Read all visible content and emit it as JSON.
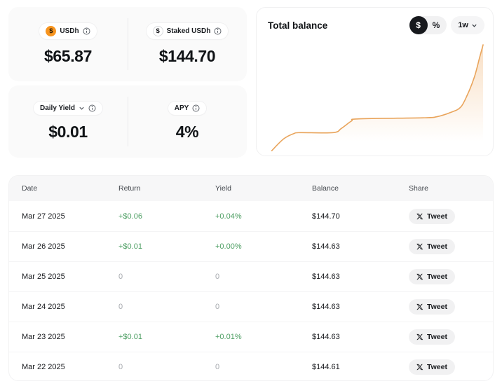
{
  "colors": {
    "accent_orange": "#f7941e",
    "chart_line": "#e9a45b",
    "chart_fill_top": "rgba(238,171,101,0.38)",
    "positive_green": "#4c9e62",
    "zero_gray": "#a6a9ae"
  },
  "stats": {
    "usdh": {
      "label": "USDh",
      "value": "$65.87",
      "coin_symbol": "$"
    },
    "staked": {
      "label": "Staked USDh",
      "value": "$144.70",
      "coin_symbol": "$"
    },
    "daily_yield": {
      "label": "Daily Yield",
      "value": "$0.01"
    },
    "apy": {
      "label": "APY",
      "value": "4%"
    }
  },
  "chart_header": {
    "title": "Total balance",
    "toggle": {
      "selected": "$",
      "unselected": "%"
    },
    "range": "1w"
  },
  "chart_data": {
    "type": "area",
    "title": "Total balance",
    "xlabel": "",
    "ylabel": "",
    "axes_visible": false,
    "grid": false,
    "legend": "none",
    "range_selected": "1w",
    "unit_selected": "$",
    "series": [
      {
        "name": "Total balance (relative, 0-100 of peak; no axis labels shown)",
        "x_rel": [
          2.5,
          7.9,
          12.6,
          15.7,
          30.8,
          34.6,
          39.3,
          42.5,
          72.3,
          78.6,
          84.9,
          89.6,
          92.8,
          95.9,
          98.4,
          100
        ],
        "values_rel": [
          0,
          11,
          16,
          17,
          17,
          21,
          28,
          30,
          31,
          32,
          36,
          41,
          53,
          69,
          88,
          100
        ]
      }
    ]
  },
  "table": {
    "columns": [
      "Date",
      "Return",
      "Yield",
      "Balance",
      "Share"
    ],
    "share_button_label": "Tweet",
    "rows": [
      {
        "date": "Mar 27 2025",
        "return": "+$0.06",
        "yield": "+0.04%",
        "balance": "$144.70",
        "positive": true
      },
      {
        "date": "Mar 26 2025",
        "return": "+$0.01",
        "yield": "+0.00%",
        "balance": "$144.63",
        "positive": true
      },
      {
        "date": "Mar 25 2025",
        "return": "0",
        "yield": "0",
        "balance": "$144.63",
        "positive": false
      },
      {
        "date": "Mar 24 2025",
        "return": "0",
        "yield": "0",
        "balance": "$144.63",
        "positive": false
      },
      {
        "date": "Mar 23 2025",
        "return": "+$0.01",
        "yield": "+0.01%",
        "balance": "$144.63",
        "positive": true
      },
      {
        "date": "Mar 22 2025",
        "return": "0",
        "yield": "0",
        "balance": "$144.61",
        "positive": false
      }
    ]
  }
}
